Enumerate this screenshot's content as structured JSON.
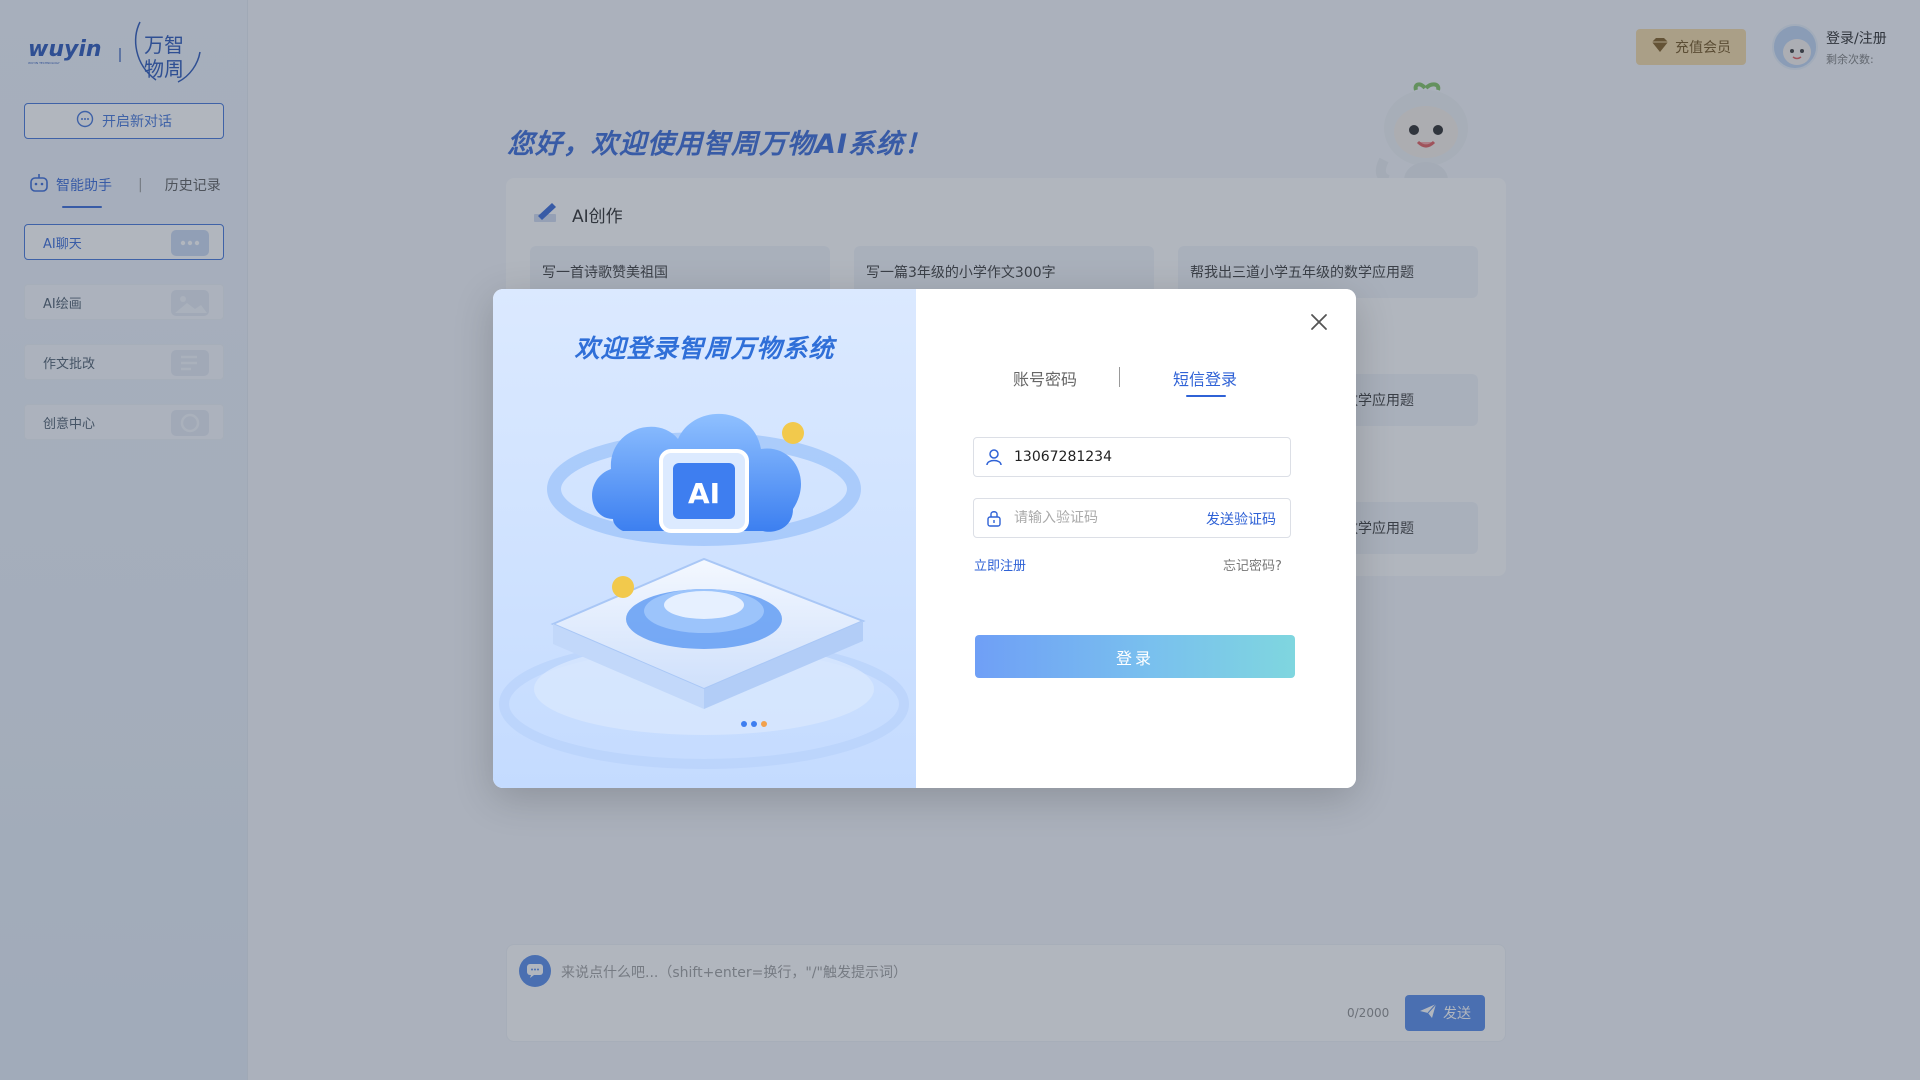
{
  "sidebar": {
    "new_chat_label": "开启新对话",
    "tabs": [
      {
        "label": "智能助手"
      },
      {
        "label": "历史记录"
      }
    ],
    "tab_separator": "|",
    "items": [
      {
        "label": "AI聊天"
      },
      {
        "label": "AI绘画"
      },
      {
        "label": "作文批改"
      },
      {
        "label": "创意中心"
      }
    ]
  },
  "header": {
    "vip_label": "充值会员",
    "login_label": "登录/注册",
    "remaining_label": "剩余次数:"
  },
  "main": {
    "greeting": "您好，欢迎使用智周万物AI系统！",
    "section_title": "AI创作",
    "prompts": [
      "写一首诗歌赞美祖国",
      "写一篇3年级的小学作文300字",
      "帮我出三道小学五年级的数学应用题",
      "数学应用题",
      "数学应用题"
    ]
  },
  "chat_input": {
    "placeholder": "来说点什么吧...（shift+enter=换行，\"/\"触发提示词）",
    "char_count": "0/2000",
    "send_label": "发送"
  },
  "modal": {
    "left_title": "欢迎登录智周万物系统",
    "tabs": [
      {
        "label": "账号密码"
      },
      {
        "label": "短信登录"
      }
    ],
    "tab_separator": "|",
    "active_tab": "短信登录",
    "phone_value": "13067281234",
    "code_placeholder": "请输入验证码",
    "send_code_label": "发送验证码",
    "register_label": "立即注册",
    "forgot_label": "忘记密码?",
    "login_button_label": "登录",
    "illustration_text": "AI"
  },
  "colors": {
    "brand_blue": "#2f62d6",
    "vip_gold": "#f3d7a1",
    "login_gradient_start": "#6f9ff6",
    "login_gradient_end": "#7fd6df"
  },
  "icons": {
    "logo": "wuyin-logo",
    "new_chat": "chat-bubble-icon",
    "assistant": "robot-icon",
    "vip": "diamond-icon",
    "close": "close-icon",
    "user": "user-icon",
    "lock": "lock-icon",
    "send": "paper-plane-icon",
    "section": "pen-icon"
  }
}
